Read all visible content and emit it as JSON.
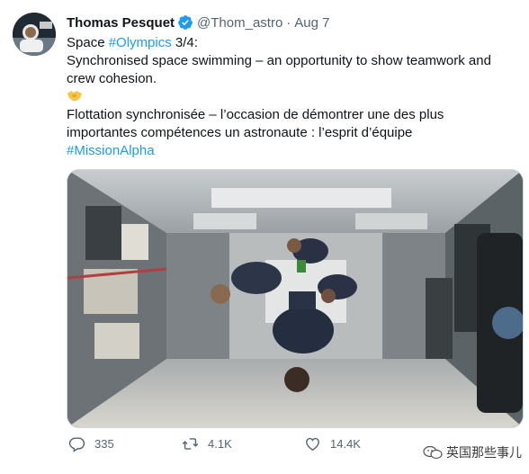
{
  "tweet": {
    "author_name": "Thomas Pesquet",
    "handle": "@Thom_astro",
    "separator": "·",
    "date": "Aug 7",
    "line1_prefix": "Space ",
    "line1_hashtag": "#Olympics",
    "line1_suffix": " 3/4:",
    "line2": "Synchronised space swimming – an opportunity to show teamwork and crew cohesion.",
    "emoji": "handshake-emoji",
    "line3": "Flottation synchronisée – l’occasion de démontrer une des plus importantes compétences un astronaute : l’esprit d’équipe",
    "hashtag2": "#MissionAlpha"
  },
  "actions": {
    "replies": "335",
    "retweets": "4.1K",
    "likes": "14.4K"
  },
  "watermark": {
    "text": "英国那些事儿"
  },
  "colors": {
    "link": "#1d9bf0",
    "secondary_text": "#536471",
    "border": "#cfd9de"
  }
}
